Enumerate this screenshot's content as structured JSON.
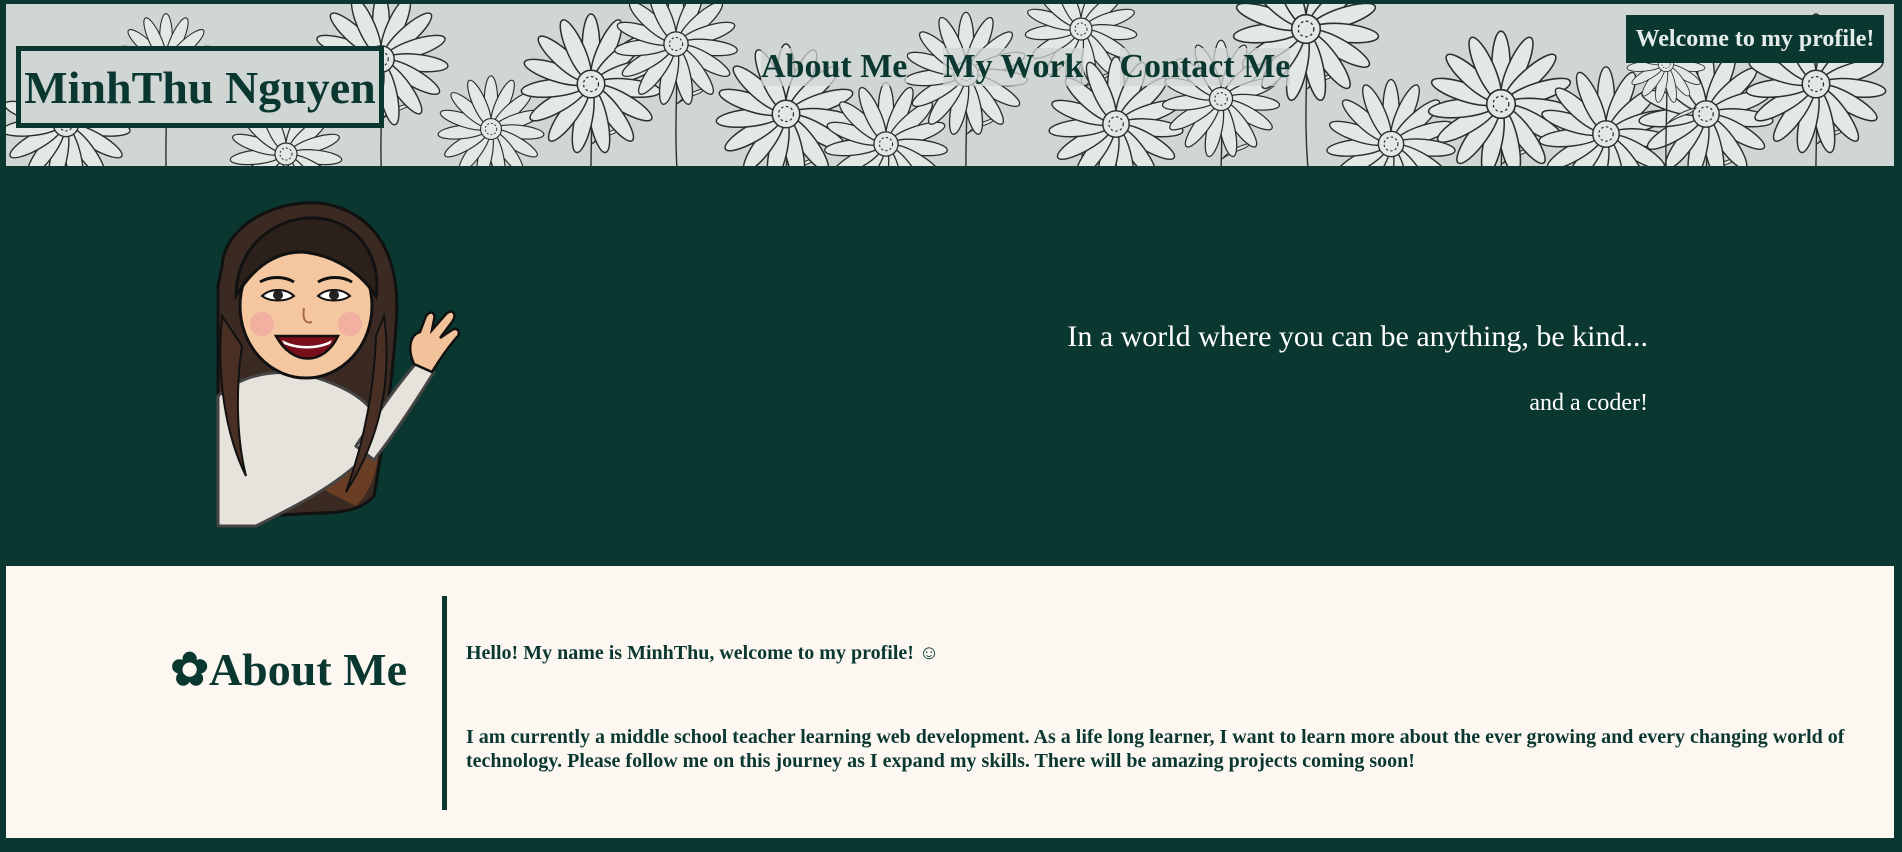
{
  "header": {
    "brand": "MinhThu Nguyen",
    "nav": [
      "About Me",
      "My Work",
      "Contact Me"
    ],
    "welcome": "Welcome to my profile!"
  },
  "hero": {
    "quote": "In a world where you can be anything, be kind...",
    "subquote": "and a coder!",
    "avatar_icon": "waving-avatar-illustration"
  },
  "about": {
    "icon": "✿",
    "title": "About Me",
    "greeting": "Hello! My name is MinhThu, welcome to my profile! ☺",
    "body": "I am currently a middle school teacher learning web development. As a life long learner, I want to learn more about the ever growing and every changing world of technology. Please follow me on this journey as I expand my skills. There will be amazing projects coming soon!"
  },
  "colors": {
    "primary": "#0a3730",
    "header_bg": "#d0d6d3",
    "about_bg": "#fcf8f1",
    "hero_text": "#ffffff"
  }
}
